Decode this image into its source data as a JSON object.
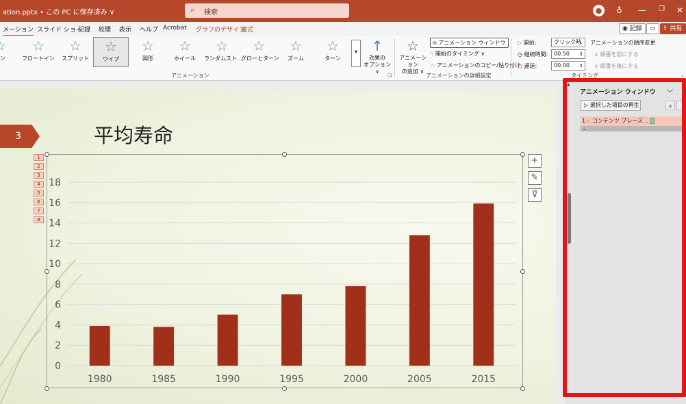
{
  "titlebar": {
    "doc_title": "ation.pptx • この PC に保存済み ∨",
    "search_placeholder": "検索",
    "search_icon": "search-icon",
    "window_icons": [
      "account-icon",
      "lightbulb-icon",
      "minimize-icon",
      "restore-icon",
      "close-icon"
    ]
  },
  "menu": {
    "tabs": [
      "メーション",
      "スライド ショー",
      "記録",
      "校閲",
      "表示",
      "ヘルプ",
      "Acrobat",
      "グラフのデザイン",
      "書式"
    ],
    "record_button": "記録",
    "share_button": "共有"
  },
  "ribbon": {
    "animations": [
      {
        "label": "イン"
      },
      {
        "label": "フロートイン"
      },
      {
        "label": "スプリット"
      },
      {
        "label": "ワイプ",
        "selected": true
      },
      {
        "label": "図形"
      },
      {
        "label": "ホイール"
      },
      {
        "label": "ランダムスト…"
      },
      {
        "label": "グローとターン"
      },
      {
        "label": "ズーム"
      },
      {
        "label": "ターン"
      }
    ],
    "animation_group_label": "アニメーション",
    "effect_options": [
      "効果の",
      "オプション ∨"
    ],
    "add_animation": [
      "アニメーション",
      "の追加 ∨"
    ],
    "animation_pane_button": "アニメーション ウィンドウ",
    "trigger_button": "開始のタイミング ∨",
    "painter_button": "アニメーションのコピー/貼り付け",
    "advanced_group_label": "アニメーションの詳細設定",
    "timing": {
      "start_label": "開始:",
      "start_value": "クリック時",
      "duration_label": "継続時間:",
      "duration_value": "00.50",
      "delay_label": "遅延:",
      "delay_value": "00.00",
      "group_label": "タイミング"
    },
    "reorder": {
      "heading": "アニメーションの順序変更",
      "move_earlier": "∧ 順番を前にする",
      "move_later": "∨ 順番を後にする"
    }
  },
  "slide": {
    "number": "3",
    "title": "平均寿命",
    "sequence_tags": [
      "1",
      "2",
      "3",
      "4",
      "5",
      "6",
      "7",
      "8"
    ]
  },
  "chart_data": {
    "type": "bar",
    "categories": [
      "1980",
      "1985",
      "1990",
      "1995",
      "2000",
      "2005",
      "2015"
    ],
    "values": [
      3.9,
      3.8,
      5.0,
      7.0,
      7.8,
      12.8,
      15.9
    ],
    "ylim": [
      0,
      18
    ],
    "yticks": [
      "0",
      "2",
      "4",
      "6",
      "8",
      "10",
      "12",
      "14",
      "16",
      "18"
    ],
    "grid": true,
    "bar_color": "#a0301a"
  },
  "chart_tools": [
    "chart-elements-icon",
    "chart-styles-icon",
    "chart-filters-icon"
  ],
  "pane": {
    "title": "アニメーション ウィンドウ",
    "play_button": "選択した項目の再生",
    "items": [
      {
        "number": "1",
        "label": "コンテンツ プレース…"
      }
    ],
    "expand_glyph": "⌄"
  },
  "colors": {
    "brand": "#b7472a",
    "highlight_border": "#e41515",
    "animation_star": "#4caf50"
  }
}
